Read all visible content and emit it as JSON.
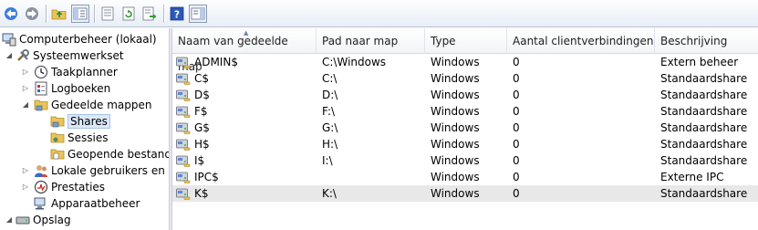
{
  "toolbar": {
    "buttons": [
      {
        "icon": "back-arrow-icon",
        "color": "#2f6fd0"
      },
      {
        "icon": "forward-arrow-icon",
        "color": "#7b8596"
      },
      {
        "icon": "up-folder-icon"
      },
      {
        "icon": "show-hide-tree-icon"
      },
      {
        "icon": "properties-icon"
      },
      {
        "icon": "refresh-icon"
      },
      {
        "icon": "export-list-icon"
      },
      {
        "icon": "help-icon"
      },
      {
        "icon": "show-hide-action-pane-icon"
      }
    ]
  },
  "tree": {
    "items": [
      {
        "label": "Computerbeheer (lokaal)",
        "icon": "computer-management-icon"
      },
      {
        "label": "Systeemwerkset",
        "icon": "system-tools-icon"
      },
      {
        "label": "Taakplanner",
        "icon": "task-scheduler-icon"
      },
      {
        "label": "Logboeken",
        "icon": "event-viewer-icon"
      },
      {
        "label": "Gedeelde mappen",
        "icon": "shared-folders-icon"
      },
      {
        "label": "Shares",
        "icon": "shares-icon"
      },
      {
        "label": "Sessies",
        "icon": "sessions-icon"
      },
      {
        "label": "Geopende bestanden",
        "icon": "open-files-icon"
      },
      {
        "label": "Lokale gebruikers en groepen",
        "icon": "local-users-icon"
      },
      {
        "label": "Prestaties",
        "icon": "performance-icon"
      },
      {
        "label": "Apparaatbeheer",
        "icon": "device-manager-icon"
      },
      {
        "label": "Opslag",
        "icon": "storage-icon"
      }
    ]
  },
  "list": {
    "columns": [
      "Naam van gedeelde map",
      "Pad naar map",
      "Type",
      "Aantal clientverbindingen",
      "Beschrijving"
    ],
    "rows": [
      {
        "name": "ADMIN$",
        "path": "C:\\Windows",
        "type": "Windows",
        "connections": "0",
        "description": "Extern beheer"
      },
      {
        "name": "C$",
        "path": "C:\\",
        "type": "Windows",
        "connections": "0",
        "description": "Standaardshare"
      },
      {
        "name": "D$",
        "path": "D:\\",
        "type": "Windows",
        "connections": "0",
        "description": "Standaardshare"
      },
      {
        "name": "F$",
        "path": "F:\\",
        "type": "Windows",
        "connections": "0",
        "description": "Standaardshare"
      },
      {
        "name": "G$",
        "path": "G:\\",
        "type": "Windows",
        "connections": "0",
        "description": "Standaardshare"
      },
      {
        "name": "H$",
        "path": "H:\\",
        "type": "Windows",
        "connections": "0",
        "description": "Standaardshare"
      },
      {
        "name": "I$",
        "path": "I:\\",
        "type": "Windows",
        "connections": "0",
        "description": "Standaardshare"
      },
      {
        "name": "IPC$",
        "path": "",
        "type": "Windows",
        "connections": "0",
        "description": "Externe IPC"
      },
      {
        "name": "K$",
        "path": "K:\\",
        "type": "Windows",
        "connections": "0",
        "description": "Standaardshare"
      }
    ]
  }
}
